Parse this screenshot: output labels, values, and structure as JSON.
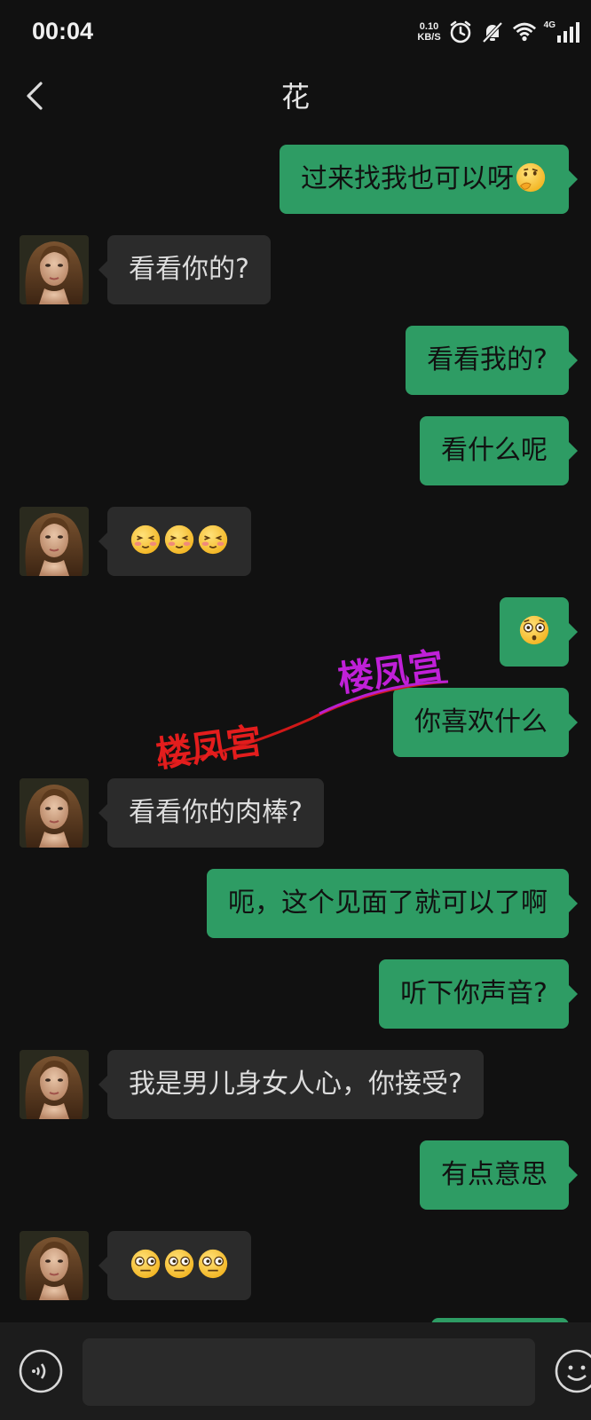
{
  "status_bar": {
    "time": "00:04",
    "net_speed_value": "0.10",
    "net_speed_unit": "KB/S",
    "network_type": "4G",
    "icons": [
      "alarm-icon",
      "mute-bell-icon",
      "wifi-icon",
      "signal-icon"
    ]
  },
  "header": {
    "title": "花",
    "back_icon": "chevron-left-icon"
  },
  "messages": [
    {
      "from": "me",
      "text": "过来找我也可以呀",
      "emoji": [
        "thinking-face"
      ]
    },
    {
      "from": "contact",
      "text": "看看你的?"
    },
    {
      "from": "me",
      "text": "看看我的?"
    },
    {
      "from": "me",
      "text": "看什么呢"
    },
    {
      "from": "contact",
      "text": "",
      "emoji": [
        "shy-face",
        "shy-face",
        "shy-face"
      ]
    },
    {
      "from": "me",
      "text": "",
      "emoji": [
        "surprised-face"
      ]
    },
    {
      "from": "me",
      "text": "你喜欢什么"
    },
    {
      "from": "contact",
      "text": "看看你的肉棒?"
    },
    {
      "from": "me",
      "text": "呃，这个见面了就可以了啊"
    },
    {
      "from": "me",
      "text": "听下你声音?"
    },
    {
      "from": "contact",
      "text": "我是男儿身女人心，你接受?"
    },
    {
      "from": "me",
      "text": "有点意思"
    },
    {
      "from": "contact",
      "text": "",
      "emoji": [
        "wide-eyed-face",
        "wide-eyed-face",
        "wide-eyed-face"
      ]
    }
  ],
  "watermarks": [
    "楼凤宫",
    "楼凤宫"
  ],
  "composer": {
    "voice_icon": "voice-icon",
    "emoji_icon": "emoji-icon"
  },
  "colors": {
    "background": "#111111",
    "outgoing_bubble": "#2e9c64",
    "incoming_bubble": "#2b2b2b"
  }
}
